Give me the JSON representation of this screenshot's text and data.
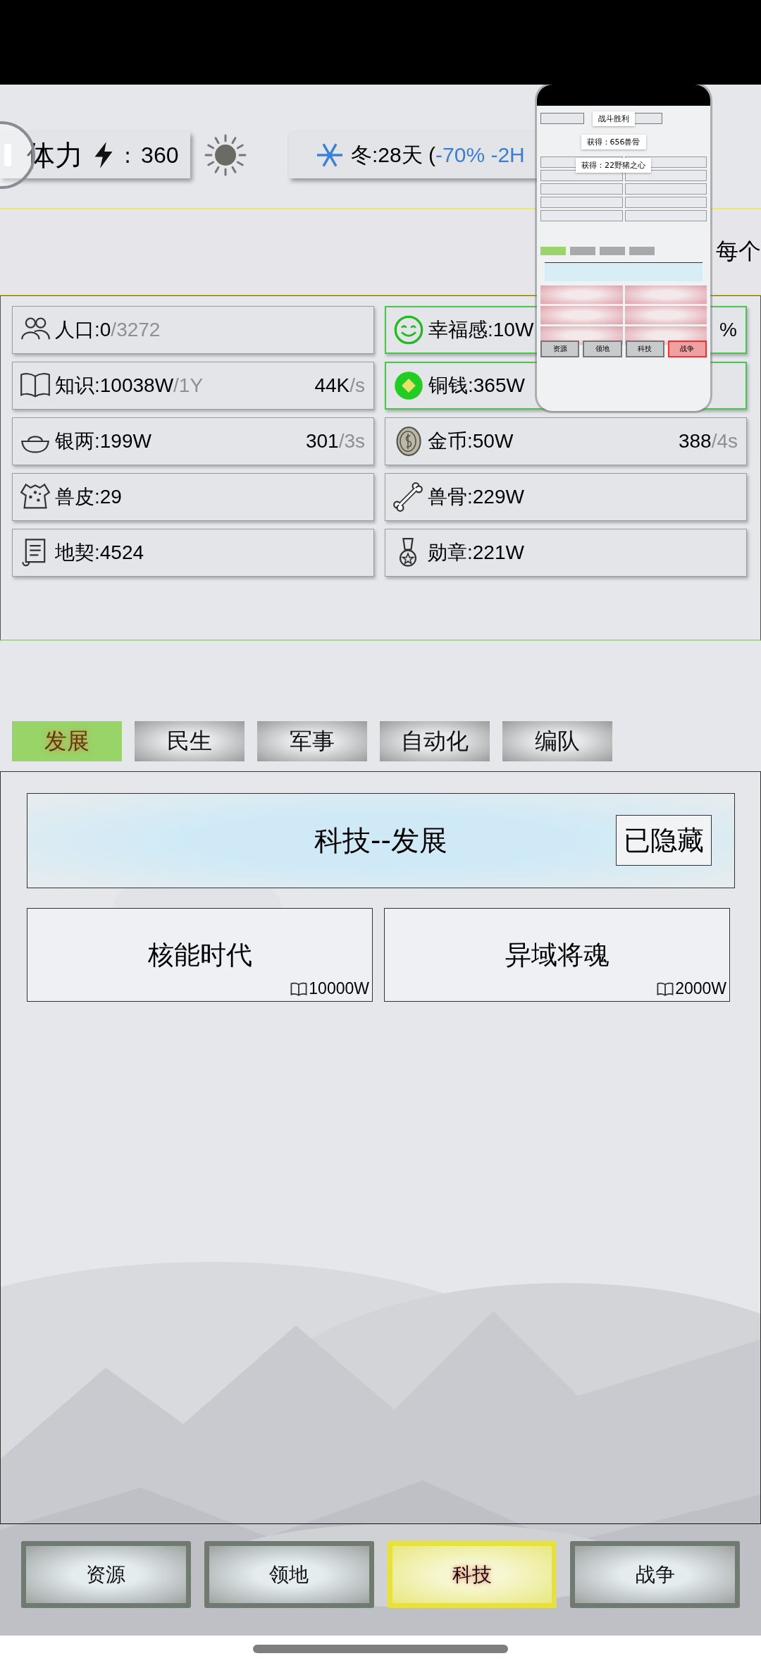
{
  "top_bar": {
    "stamina": {
      "label": "体力",
      "separator": ":",
      "value": "360"
    },
    "season": {
      "text": "冬:28天 (",
      "effect": "-70% -2H"
    }
  },
  "marquee": "每个",
  "resources": [
    {
      "value": "人口:0",
      "limit": "/3272",
      "highlighted": false
    },
    {
      "value": "幸福感:10W",
      "rate": "%",
      "highlighted": true
    },
    {
      "value": "知识:10038W",
      "limit": "/1Y",
      "rate": "44K",
      "period": "/s",
      "highlighted": false
    },
    {
      "value": "铜钱:365W",
      "highlighted": true
    },
    {
      "value": "银两:199W",
      "rate": "301",
      "period": "/3s",
      "highlighted": false
    },
    {
      "value": "金币:50W",
      "rate": "388",
      "period": "/4s",
      "highlighted": false
    },
    {
      "value": "兽皮:29",
      "highlighted": false
    },
    {
      "value": "兽骨:229W",
      "highlighted": false
    },
    {
      "value": "地契:4524",
      "highlighted": false
    },
    {
      "value": "勋章:221W",
      "highlighted": false
    }
  ],
  "tabs": [
    {
      "label": "发展",
      "selected": true
    },
    {
      "label": "民生",
      "selected": false
    },
    {
      "label": "军事",
      "selected": false
    },
    {
      "label": "自动化",
      "selected": false
    },
    {
      "label": "编队",
      "selected": false
    }
  ],
  "panel": {
    "title": "科技--发展",
    "toggle": "已隐藏"
  },
  "techs": [
    {
      "name": "核能时代",
      "cost": "10000W"
    },
    {
      "name": "异域将魂",
      "cost": "2000W"
    }
  ],
  "nav": [
    {
      "label": "资源",
      "selected": false
    },
    {
      "label": "领地",
      "selected": false
    },
    {
      "label": "科技",
      "selected": true
    },
    {
      "label": "战争",
      "selected": false
    }
  ],
  "screenshot_preview": {
    "tooltips": [
      "战斗胜利",
      "获得：656兽骨",
      "获得：22野猪之心"
    ],
    "nav": [
      {
        "label": "资源",
        "selected": false
      },
      {
        "label": "领地",
        "selected": false
      },
      {
        "label": "科技",
        "selected": false
      },
      {
        "label": "战争",
        "selected": true
      }
    ]
  }
}
